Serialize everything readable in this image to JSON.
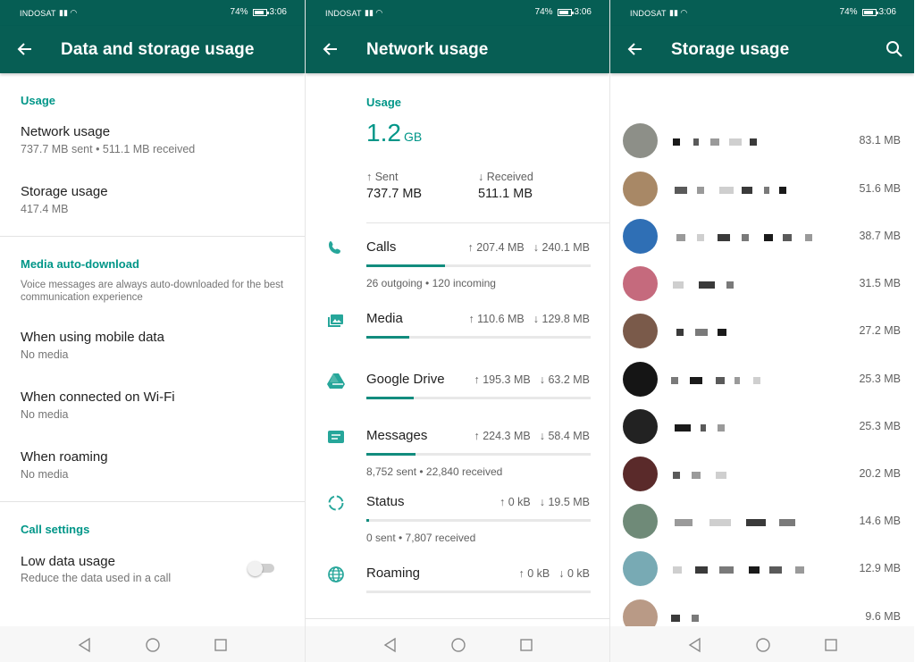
{
  "status_bar": {
    "carrier": "INDOSAT",
    "battery": "74%",
    "time": "3:06"
  },
  "colors": {
    "toolbar": "#075e54",
    "accent": "#009688",
    "bar": "#128c7e"
  },
  "icons": {
    "back": "arrow-back-icon",
    "search": "search-icon",
    "nav": [
      "nav-back-icon",
      "nav-home-icon",
      "nav-recents-icon"
    ]
  },
  "data_storage": {
    "title": "Data and storage usage",
    "usage_header": "Usage",
    "network_title": "Network usage",
    "network_sub": "737.7 MB sent • 511.1 MB received",
    "storage_title": "Storage usage",
    "storage_sub": "417.4 MB",
    "media_header": "Media auto-download",
    "media_note": "Voice messages are always auto-downloaded for the best communication experience",
    "mobile_title": "When using mobile data",
    "mobile_sub": "No media",
    "wifi_title": "When connected on Wi-Fi",
    "wifi_sub": "No media",
    "roaming_title": "When roaming",
    "roaming_sub": "No media",
    "call_header": "Call settings",
    "low_data_title": "Low data usage",
    "low_data_sub": "Reduce the data used in a call",
    "low_data_enabled": false
  },
  "network_usage": {
    "title": "Network usage",
    "usage_label": "Usage",
    "total_value": "1.2",
    "total_unit": "GB",
    "sent_label": "↑ Sent",
    "sent_value": "737.7 MB",
    "received_label": "↓ Received",
    "received_value": "511.1 MB",
    "categories": [
      {
        "name": "Calls",
        "icon": "phone-icon",
        "sent": "↑ 207.4 MB",
        "received": "↓ 240.1 MB",
        "progress": 0.35,
        "detail": "26 outgoing • 120 incoming"
      },
      {
        "name": "Media",
        "icon": "photos-icon",
        "sent": "↑ 110.6 MB",
        "received": "↓ 129.8 MB",
        "progress": 0.19,
        "detail": ""
      },
      {
        "name": "Google Drive",
        "icon": "google-drive-icon",
        "sent": "↑ 195.3 MB",
        "received": "↓ 63.2 MB",
        "progress": 0.21,
        "detail": ""
      },
      {
        "name": "Messages",
        "icon": "message-icon",
        "sent": "↑ 224.3 MB",
        "received": "↓ 58.4 MB",
        "progress": 0.22,
        "detail": "8,752 sent • 22,840 received"
      },
      {
        "name": "Status",
        "icon": "status-icon",
        "sent": "↑ 0 kB",
        "received": "↓ 19.5 MB",
        "progress": 0.01,
        "detail": "0 sent • 7,807 received"
      },
      {
        "name": "Roaming",
        "icon": "globe-icon",
        "sent": "↑ 0 kB",
        "received": "↓ 0 kB",
        "progress": 0,
        "detail": ""
      }
    ]
  },
  "storage_usage": {
    "title": "Storage usage",
    "chats": [
      {
        "size": "83.1 MB",
        "avatar": "#8d8f88"
      },
      {
        "size": "51.6 MB",
        "avatar": "#a88866"
      },
      {
        "size": "38.7 MB",
        "avatar": "#2f6fb5"
      },
      {
        "size": "31.5 MB",
        "avatar": "#c56a7d"
      },
      {
        "size": "27.2 MB",
        "avatar": "#7a5a4a"
      },
      {
        "size": "25.3 MB",
        "avatar": "#151515"
      },
      {
        "size": "25.3 MB",
        "avatar": "#222222"
      },
      {
        "size": "20.2 MB",
        "avatar": "#5a2a2a"
      },
      {
        "size": "14.6 MB",
        "avatar": "#6f8a78"
      },
      {
        "size": "12.9 MB",
        "avatar": "#78aab4"
      },
      {
        "size": "9.6 MB",
        "avatar": "#b99a86"
      }
    ]
  }
}
